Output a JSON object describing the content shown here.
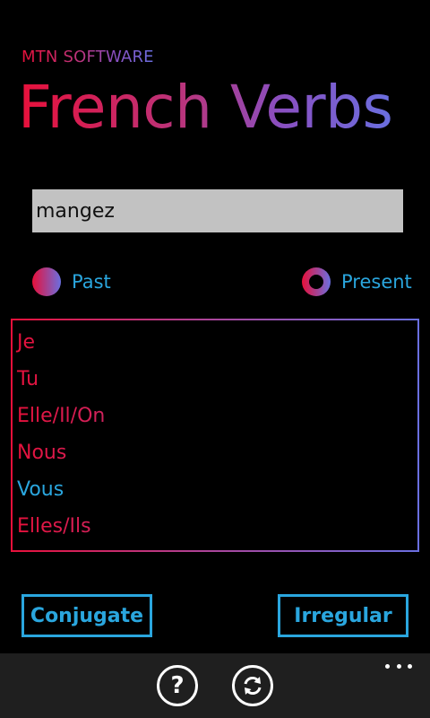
{
  "header": {
    "company": "MTN SOFTWARE",
    "title": "French Verbs"
  },
  "verb_input": {
    "value": "mangez",
    "placeholder": ""
  },
  "tense": {
    "options": [
      {
        "label": "Past",
        "selected": false
      },
      {
        "label": "Present",
        "selected": true
      }
    ]
  },
  "pronouns": [
    "Je",
    "Tu",
    "Elle/Il/On",
    "Nous",
    "Vous",
    "Elles/Ils"
  ],
  "buttons": {
    "conjugate": "Conjugate",
    "irregular": "Irregular"
  },
  "app_bar": {
    "icons": [
      "help-icon",
      "refresh-icon",
      "more-icon"
    ]
  },
  "colors": {
    "accent": "#2aa6de",
    "gradient_start": "#e8103a",
    "gradient_end": "#6a6fe0",
    "input_bg": "#c2c2c2",
    "app_bar_bg": "#1f1f1f"
  }
}
